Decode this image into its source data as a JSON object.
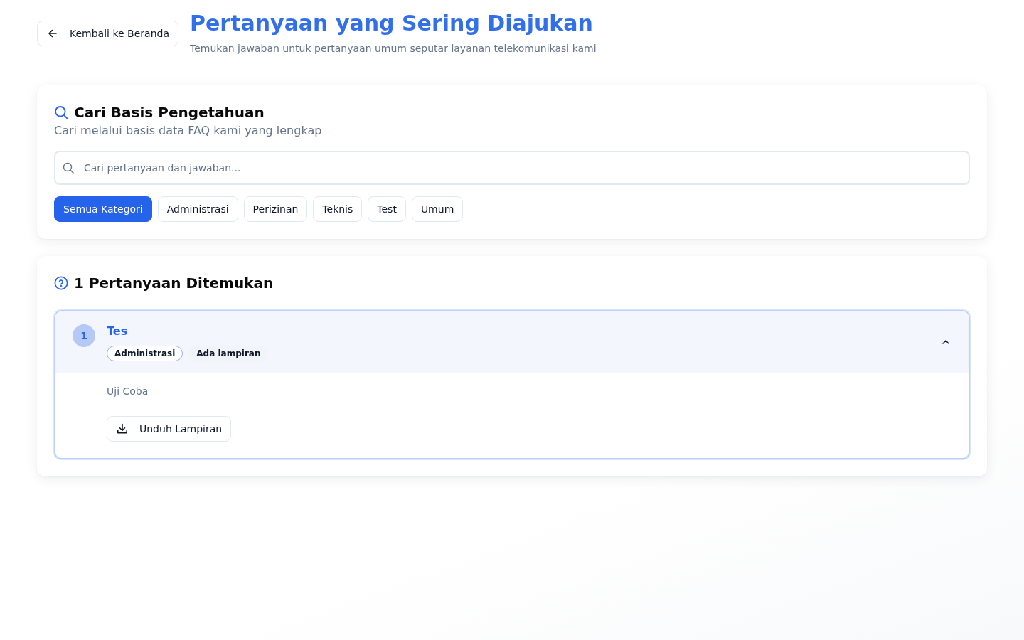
{
  "header": {
    "back_button": {
      "label": "Kembali ke Beranda"
    },
    "title": "Pertanyaan yang Sering Diajukan",
    "subtitle": "Temukan jawaban untuk pertanyaan umum seputar layanan telekomunikasi kami"
  },
  "search_card": {
    "title": "Cari Basis Pengetahuan",
    "subtitle": "Cari melalui basis data FAQ kami yang lengkap",
    "search": {
      "placeholder": "Cari pertanyaan dan jawaban..."
    },
    "categories": [
      {
        "label": "Semua Kategori",
        "selected": true
      },
      {
        "label": "Administrasi",
        "selected": false
      },
      {
        "label": "Perizinan",
        "selected": false
      },
      {
        "label": "Teknis",
        "selected": false
      },
      {
        "label": "Test",
        "selected": false
      },
      {
        "label": "Umum",
        "selected": false
      }
    ]
  },
  "results": {
    "heading": "1 Pertanyaan Ditemukan",
    "faqs": [
      {
        "number": "1",
        "question": "Tes",
        "tags": [
          {
            "label": "Administrasi",
            "kind": "category"
          },
          {
            "label": "Ada lampiran",
            "kind": "attachment"
          }
        ],
        "expanded": true,
        "answer": "Uji Coba",
        "attachment_button": {
          "label": "Unduh Lampiran"
        }
      }
    ]
  }
}
